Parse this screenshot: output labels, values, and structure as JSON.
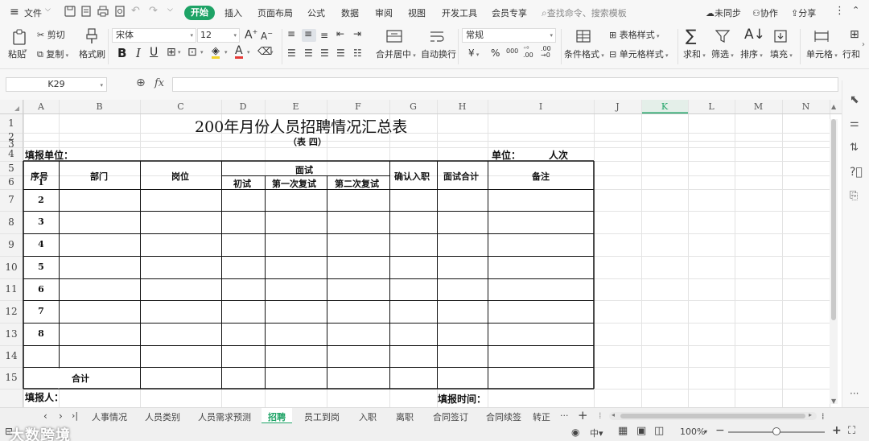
{
  "menubar": {
    "file": "文件",
    "start": "开始",
    "items": [
      "插入",
      "页面布局",
      "公式",
      "数据",
      "审阅",
      "视图",
      "开发工具",
      "会员专享"
    ],
    "search_placeholder": "查找命令、搜索模板",
    "sync": "未同步",
    "collab": "协作",
    "share": "分享"
  },
  "ribbon": {
    "paste": "粘贴",
    "cut": "剪切",
    "copy": "复制",
    "format_painter": "格式刷",
    "font": "宋体",
    "size": "12",
    "merge_center": "合并居中",
    "wrap": "自动换行",
    "number_format": "常规",
    "currency": "¥",
    "percent": "%",
    "thousands": "000",
    "cond_format": "条件格式",
    "table_style": "表格样式",
    "cell_style": "单元格样式",
    "sum": "求和",
    "filter": "筛选",
    "sort": "排序",
    "fill": "填充",
    "cell": "单元格",
    "row_col": "行和"
  },
  "formula": {
    "namebox": "K29",
    "fx": "fx"
  },
  "grid": {
    "columns": [
      "A",
      "B",
      "C",
      "D",
      "E",
      "F",
      "G",
      "H",
      "I",
      "J",
      "K",
      "L",
      "M",
      "N"
    ],
    "rows": [
      "1",
      "2",
      "3",
      "4",
      "5",
      "6",
      "7",
      "8",
      "9",
      "10",
      "11",
      "12",
      "13",
      "14",
      "15"
    ],
    "active_column": "K"
  },
  "sheet": {
    "title": "200年月份人员招聘情况汇总表",
    "subtitle": "（表 四）",
    "fill_unit": "填报单位：",
    "unit_label": "单位：",
    "unit_value": "人次",
    "headers": {
      "seq": "序号",
      "dept": "部门",
      "position": "岗位",
      "interview": "面试",
      "first": "初试",
      "second": "第一次复试",
      "third": "第二次复试",
      "confirm": "确认入职",
      "total": "面试合计",
      "remark": "备注"
    },
    "row_numbers": [
      "1",
      "2",
      "3",
      "4",
      "5",
      "6",
      "7",
      "8"
    ],
    "sum_label": "合计",
    "filler": "填报人：",
    "fill_time": "填报时间："
  },
  "tabs": {
    "items": [
      "人事情况",
      "人员类别",
      "人员需求预测",
      "招聘",
      "员工到岗",
      "入职",
      "离职",
      "合同签订",
      "合同续签",
      "转正"
    ],
    "active": "招聘",
    "more": "···",
    "add": "+"
  },
  "status": {
    "watermark": "大数跨境",
    "zoom": "100%"
  },
  "colors": {
    "accent": "#1ea366",
    "active_header": "#e4efe9"
  }
}
